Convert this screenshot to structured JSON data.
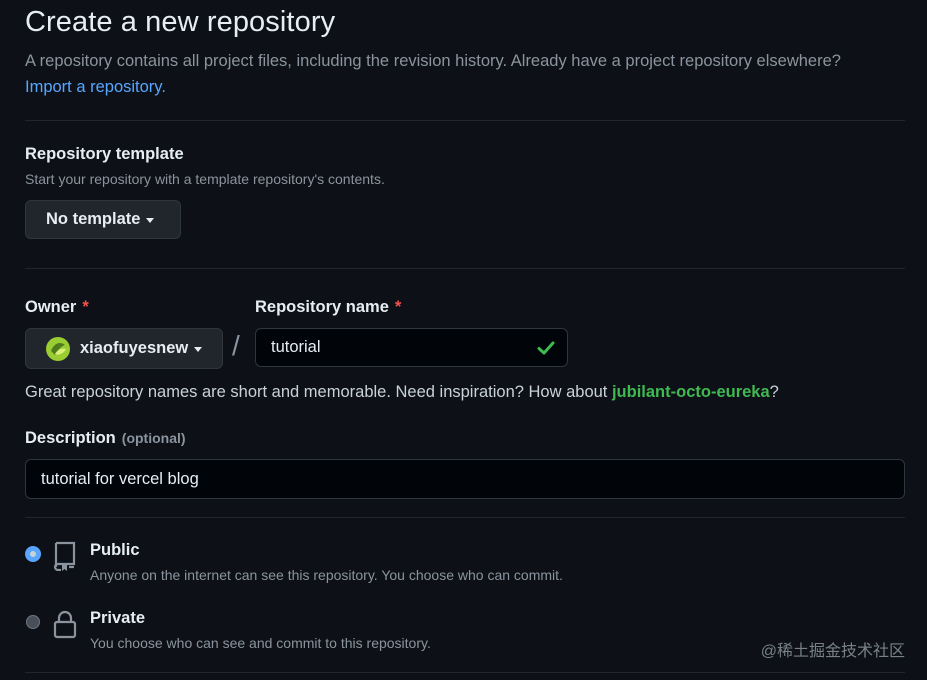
{
  "header": {
    "title": "Create a new repository",
    "description": "A repository contains all project files, including the revision history. Already have a project repository elsewhere?",
    "import_link": "Import a repository."
  },
  "template": {
    "label": "Repository template",
    "sublabel": "Start your repository with a template repository's contents.",
    "button": "No template"
  },
  "owner": {
    "label": "Owner",
    "required_mark": "*",
    "value": "xiaofuyesnew",
    "avatar_color": "#9acd32"
  },
  "separator": "/",
  "repo_name": {
    "label": "Repository name",
    "required_mark": "*",
    "value": "tutorial",
    "valid_icon": "check-icon"
  },
  "hint": {
    "prefix": "Great repository names are short and memorable. Need inspiration? How about ",
    "suggestion": "jubilant-octo-eureka",
    "suffix": "?"
  },
  "description": {
    "label": "Description",
    "optional_text": "(optional)",
    "value": "tutorial for vercel blog"
  },
  "visibility": {
    "options": [
      {
        "title": "Public",
        "desc": "Anyone on the internet can see this repository. You choose who can commit.",
        "icon": "repo-icon",
        "selected": true
      },
      {
        "title": "Private",
        "desc": "You choose who can see and commit to this repository.",
        "icon": "lock-icon",
        "selected": false
      }
    ]
  },
  "watermark": "@稀土掘金技术社区",
  "colors": {
    "background": "#0d1117",
    "link": "#58a6ff",
    "success": "#3fb950",
    "required": "#f85149"
  }
}
